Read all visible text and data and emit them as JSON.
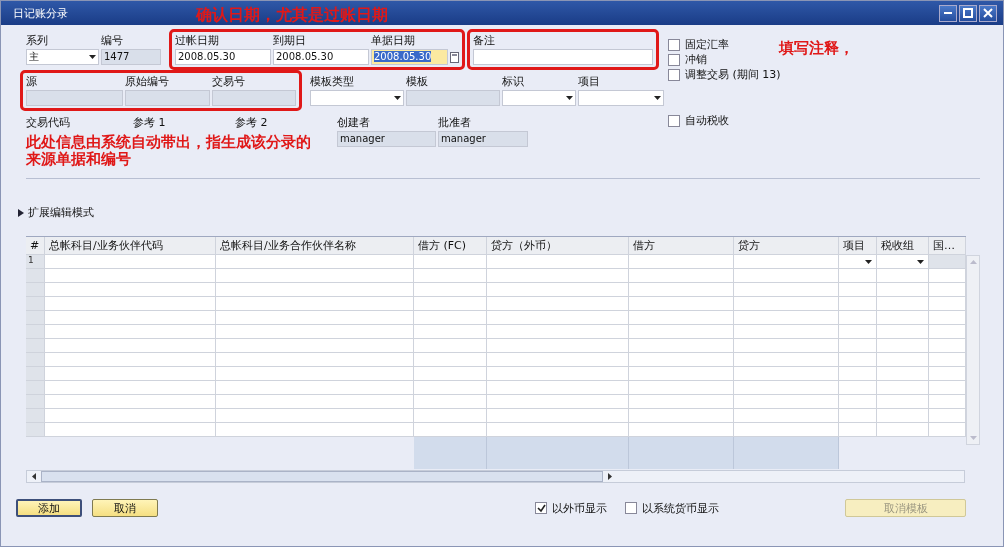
{
  "window": {
    "title": "日记账分录"
  },
  "annotations": [
    {
      "text": "确认日期，尤其是过账日期",
      "kind": "title"
    },
    {
      "text": "填写注释，",
      "kind": "remark"
    },
    {
      "text": "此处信息由系统自动带出，指生成该分录的来源单据和编号",
      "kind": "source"
    }
  ],
  "header_rows": [
    [
      {
        "label": "系列",
        "value": "主",
        "kind": "dropdown",
        "focused": false
      },
      {
        "label": "编号",
        "value": "1477",
        "kind": "readonly",
        "focused": false
      },
      {
        "label": "过帐日期",
        "value": "2008.05.30",
        "kind": "text",
        "focused": false
      },
      {
        "label": "到期日",
        "value": "2008.05.30",
        "kind": "text",
        "focused": false
      },
      {
        "label": "单据日期",
        "value": "2008.05.30",
        "kind": "date",
        "focused": true
      },
      {
        "label": "备注",
        "kind": "text",
        "focused": false
      }
    ],
    [
      {
        "label": "源",
        "kind": "readonly",
        "focused": false
      },
      {
        "label": "原始编号",
        "kind": "readonly",
        "focused": false
      },
      {
        "label": "交易号",
        "kind": "readonly",
        "focused": false
      },
      {
        "label": "模板类型",
        "kind": "dropdown",
        "focused": false
      },
      {
        "label": "模板",
        "kind": "readonly",
        "focused": false
      },
      {
        "label": "标识",
        "kind": "dropdown",
        "focused": false
      },
      {
        "label": "项目",
        "kind": "dropdown",
        "focused": false
      }
    ],
    [
      {
        "label": "交易代码",
        "kind": "label"
      },
      {
        "label": "参考 1",
        "kind": "label"
      },
      {
        "label": "参考 2",
        "kind": "label"
      },
      {
        "label": "创建者",
        "value": "manager",
        "kind": "readonly",
        "focused": false
      },
      {
        "label": "批准者",
        "value": "manager",
        "kind": "readonly",
        "focused": false
      }
    ]
  ],
  "options": [
    {
      "label": "固定汇率",
      "checked": false
    },
    {
      "label": "冲销",
      "checked": false
    },
    {
      "label": "调整交易 (期间 13)",
      "checked": false
    },
    {
      "label": "自动税收",
      "checked": false
    }
  ],
  "expand_toggle": {
    "label": "扩展编辑模式",
    "expanded": false
  },
  "table": {
    "columns": [
      {
        "label": "#",
        "kind": "index"
      },
      {
        "label": "总帐科目/业务伙伴代码",
        "kind": "text"
      },
      {
        "label": "总帐科目/业务合作伙伴名称",
        "kind": "text"
      },
      {
        "label": "借方 (FC)",
        "kind": "text"
      },
      {
        "label": "贷方（外币）",
        "kind": "text"
      },
      {
        "label": "借方",
        "kind": "text"
      },
      {
        "label": "贷方",
        "kind": "text"
      },
      {
        "label": "项目",
        "kind": "dropdown"
      },
      {
        "label": "税收组",
        "kind": "dropdown"
      },
      {
        "label": "国…",
        "kind": "readonly"
      }
    ],
    "rows": [
      {
        "number": "1"
      }
    ]
  },
  "display_options": [
    {
      "label": "以外币显示",
      "checked": true
    },
    {
      "label": "以系统货币显示",
      "checked": false
    }
  ],
  "buttons": [
    {
      "label": "添加",
      "disabled": false
    },
    {
      "label": "取消",
      "disabled": false
    }
  ],
  "template_button": {
    "label": "取消模板",
    "disabled": true
  }
}
